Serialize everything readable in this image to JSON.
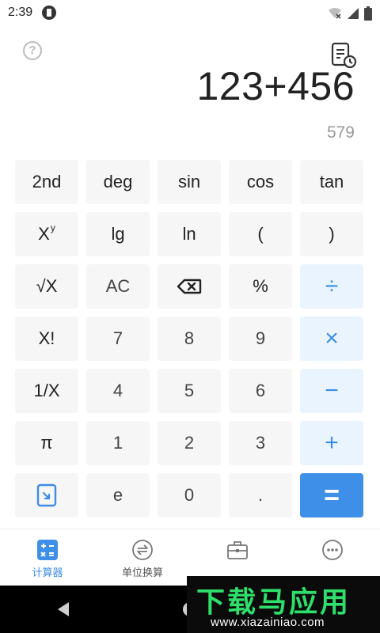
{
  "status_bar": {
    "time": "2:39"
  },
  "display": {
    "expression": "123+456",
    "result": "579",
    "help_label": "?"
  },
  "keypad": {
    "rows": [
      [
        "2nd",
        "deg",
        "sin",
        "cos",
        "tan"
      ],
      [
        "X",
        "lg",
        "ln",
        "(",
        ")"
      ],
      [
        "√X",
        "AC",
        "backspace",
        "%",
        "÷"
      ],
      [
        "X!",
        "7",
        "8",
        "9",
        "×"
      ],
      [
        "1/X",
        "4",
        "5",
        "6",
        "−"
      ],
      [
        "π",
        "1",
        "2",
        "3",
        "+"
      ],
      [
        "rotate",
        "e",
        "0",
        ".",
        "="
      ]
    ],
    "power_sup": "y"
  },
  "bottom_nav": {
    "items": [
      {
        "label": "计算器",
        "icon": "calculator-icon",
        "active": true
      },
      {
        "label": "单位换算",
        "icon": "unit-convert-icon",
        "active": false
      },
      {
        "label": "",
        "icon": "toolbox-icon",
        "active": false
      },
      {
        "label": "",
        "icon": "more-icon",
        "active": false
      }
    ]
  },
  "watermark": {
    "title": "下载马应用",
    "url": "www.xiazainiao.com"
  },
  "colors": {
    "accent": "#3d8fe8",
    "op_bg": "#eaf4fe",
    "key_bg": "#f6f6f6"
  }
}
